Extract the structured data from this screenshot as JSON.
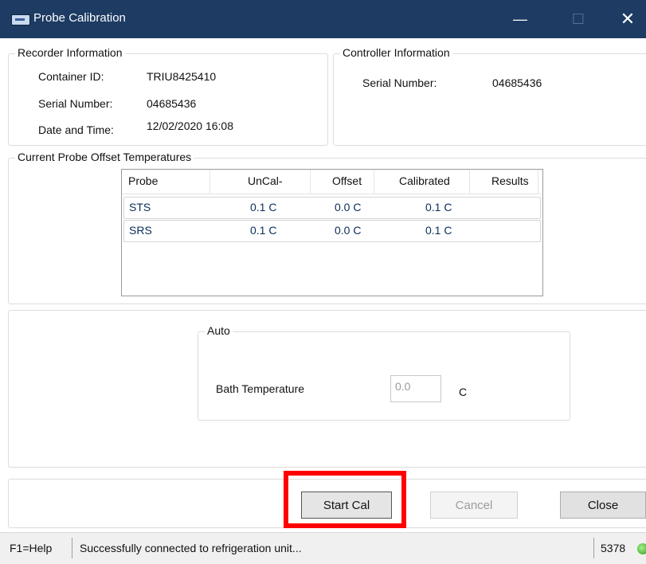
{
  "window": {
    "title": "Probe Calibration",
    "min_glyph": "—",
    "max_glyph": "☐",
    "close_glyph": "✕"
  },
  "recorder": {
    "group_title": "Recorder Information",
    "container_id_label": "Container ID:",
    "container_id": "TRIU8425410",
    "serial_label": "Serial Number:",
    "serial": "04685436",
    "datetime_label": "Date and Time:",
    "datetime": "12/02/2020 16:08"
  },
  "controller": {
    "group_title": "Controller Information",
    "serial_label": "Serial Number:",
    "serial": "04685436"
  },
  "offsets": {
    "group_title": "Current Probe Offset Temperatures",
    "columns": [
      "Probe",
      "UnCal-",
      "Offset",
      "Calibrated",
      "Results"
    ],
    "rows": [
      {
        "probe": "STS",
        "uncal": "0.1 C",
        "offset": "0.0 C",
        "calibrated": "0.1 C",
        "results": ""
      },
      {
        "probe": "SRS",
        "uncal": "0.1 C",
        "offset": "0.0 C",
        "calibrated": "0.1 C",
        "results": ""
      }
    ]
  },
  "auto": {
    "group_title": "Auto",
    "bath_label": "Bath Temperature",
    "bath_value": "0.0",
    "unit": "C"
  },
  "buttons": {
    "start": "Start Cal",
    "cancel": "Cancel",
    "close": "Close"
  },
  "status": {
    "help": "F1=Help",
    "message": "Successfully connected to refrigeration unit...",
    "code": "5378"
  },
  "colors": {
    "titlebar": "#1d3b63",
    "highlight": "#ff0000",
    "status_ok": "#2b9a1a"
  }
}
